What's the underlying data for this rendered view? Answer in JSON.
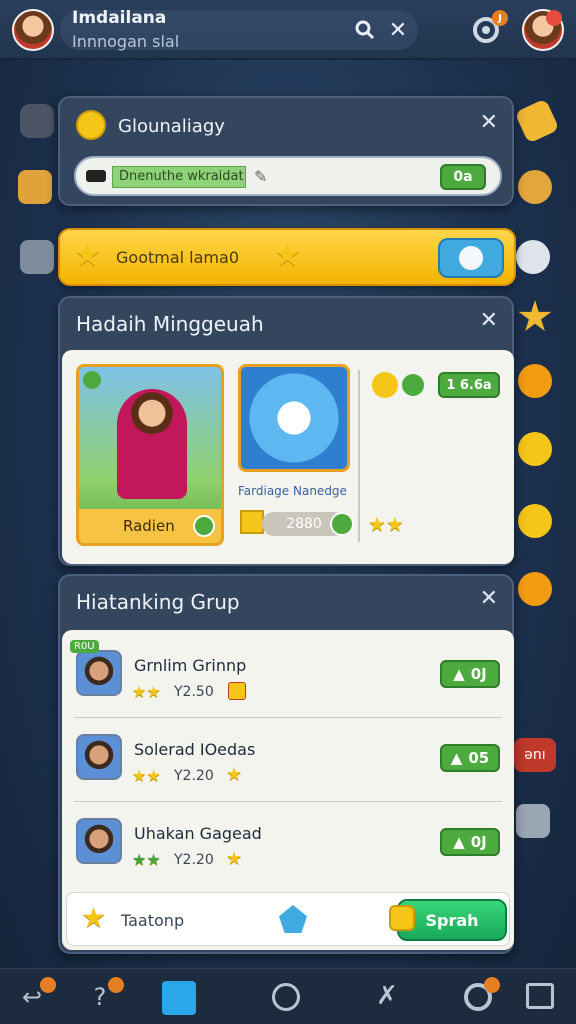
{
  "topbar": {
    "title": "Imdailana",
    "subtitle": "Innnogan slal",
    "search_icon": "search-icon",
    "close_icon": "close-icon",
    "notif_badge": "J"
  },
  "status_card": {
    "title": "Glounaliagy",
    "progress_text": "Dnenuthe wkraidat",
    "value": "0a"
  },
  "banner": {
    "text": "Gootmal lama0"
  },
  "weekly": {
    "title": "Hadaih Minggeuah",
    "card1_label": "Radien",
    "card2_label": "Fardiage Nanedge",
    "card2_price": "2880",
    "side_value": "1 6.6a"
  },
  "group": {
    "title": "Hiatanking Grup",
    "rows": [
      {
        "name": "Grnlim Grinnp",
        "price": "Y2.50",
        "action": "0J",
        "tag": "R0U"
      },
      {
        "name": "Solerad IOedas",
        "price": "Y2.20",
        "action": "05"
      },
      {
        "name": "Uhakan Gagead",
        "price": "Y2.20",
        "action": "0J"
      }
    ],
    "footer_label": "Taatonp",
    "footer_button": "Sprah"
  },
  "side_right_tag": "ǝnı",
  "nav": [
    "back-icon",
    "help-icon",
    "map-icon",
    "circle-icon",
    "cross-icon",
    "settings-icon",
    "screen-icon"
  ]
}
